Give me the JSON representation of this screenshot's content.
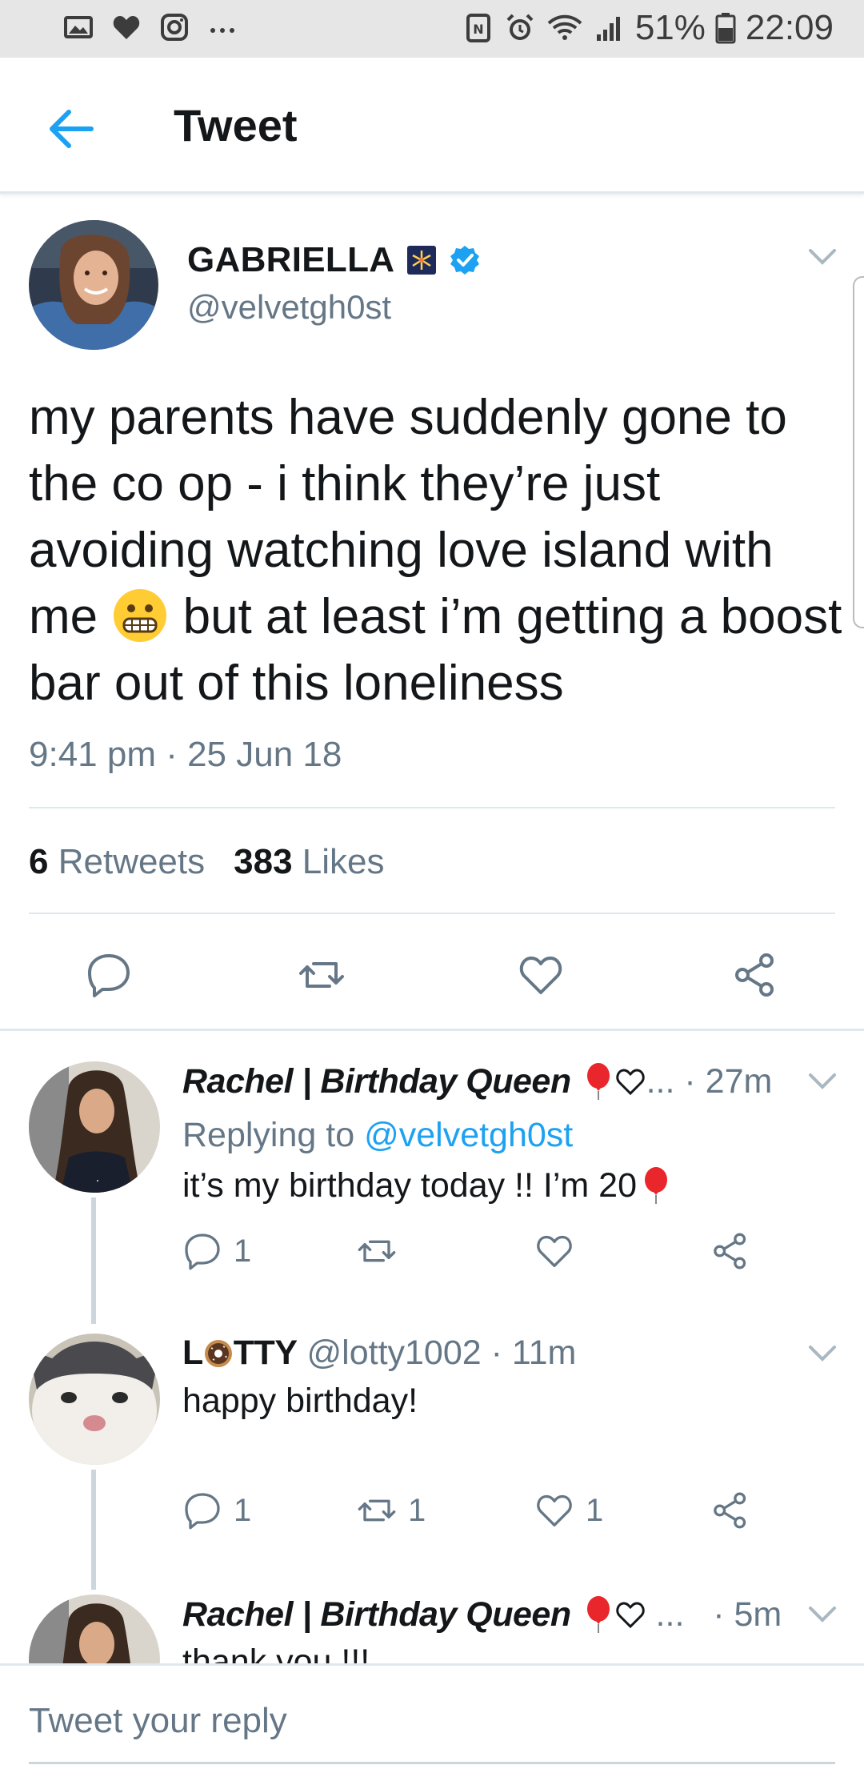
{
  "status_bar": {
    "battery": "51%",
    "time": "22:09",
    "icons_left": [
      "gallery-icon",
      "heart-icon",
      "instagram-icon",
      "more-icon"
    ],
    "icons_right": [
      "nfc-icon",
      "alarm-icon",
      "wifi-icon",
      "signal-icon",
      "battery-icon"
    ]
  },
  "header": {
    "title": "Tweet"
  },
  "main_tweet": {
    "name": "GABRIELLA",
    "handle": "@velvetgh0st",
    "text_parts": [
      "my parents have suddenly gone to the co op - i think they’re just avoiding watching love island with me ",
      " but at least i’m getting a boost bar out of this loneliness"
    ],
    "emoji": "grimacing-face",
    "time": "9:41 pm · 25 Jun 18",
    "retweets_count": "6",
    "retweets_label": "Retweets",
    "likes_count": "383",
    "likes_label": "Likes"
  },
  "replies": [
    {
      "name": "Rachel | Birthday Queen",
      "meta": " ... · 27m",
      "replying_to_label": "Replying to ",
      "replying_to_handle": "@velvetgh0st",
      "text": "it’s my birthday today !! I’m 20",
      "reply_count": "1",
      "retweet_count": "",
      "like_count": ""
    },
    {
      "name_pre": "L",
      "name_post": "TTY",
      "handle_time": "@lotty1002 · 11m",
      "text": "happy birthday!",
      "reply_count": "1",
      "retweet_count": "1",
      "like_count": "1"
    },
    {
      "name": "Rachel | Birthday Queen",
      "meta": " ...   · 5m",
      "text": "thank you !!!"
    }
  ],
  "composer": {
    "placeholder": "Tweet your reply"
  },
  "colors": {
    "accent": "#1da1f2",
    "muted": "#657786",
    "text": "#14171a",
    "divider": "#e1e8ed"
  }
}
